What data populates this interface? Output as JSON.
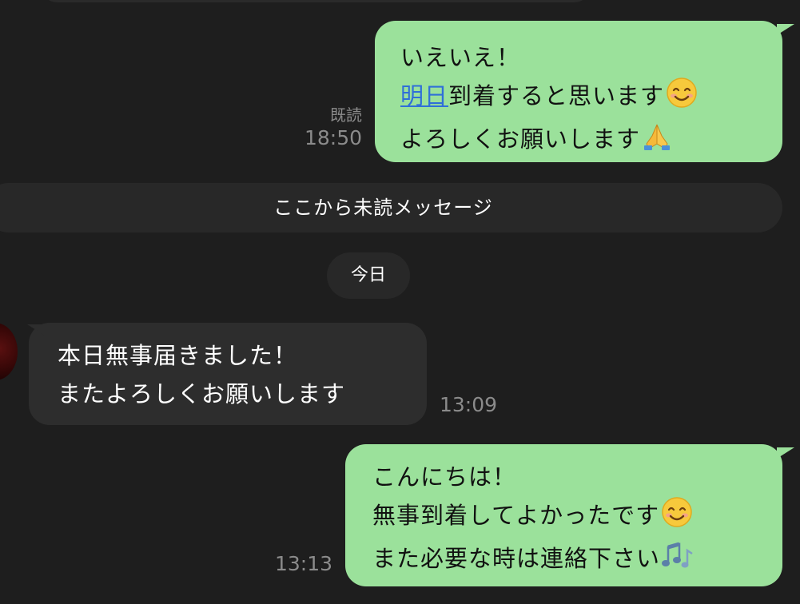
{
  "colors": {
    "background": "#1e1e1e",
    "outgoing_bubble": "#9be19b",
    "incoming_bubble": "#2d2d2d",
    "link": "#2f6fd8",
    "meta_text": "#8b8b8b"
  },
  "messages": {
    "msg1": {
      "line1": "いえいえ！",
      "line2_link": "明日",
      "line2_rest": "到着すると思います",
      "line3": "よろしくお願いします",
      "read_label": "既読",
      "time": "18:50"
    },
    "msg2": {
      "line1": "本日無事届きました！",
      "line2": "またよろしくお願いします",
      "time": "13:09"
    },
    "msg3": {
      "line1": "こんにちは！",
      "line2": "無事到着してよかったです",
      "line3": "また必要な時は連絡下さい",
      "time": "13:13"
    }
  },
  "separators": {
    "unread_label": "ここから未読メッセージ",
    "date_label": "今日"
  },
  "icons": {
    "smile": "smiling-face-emoji",
    "pray": "folded-hands-emoji",
    "music": "musical-notes-emoji"
  }
}
